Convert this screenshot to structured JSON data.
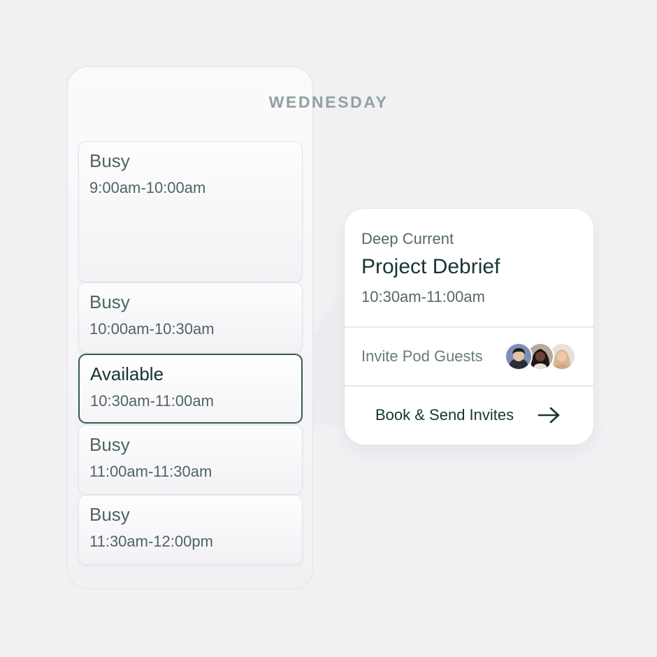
{
  "day": {
    "title": "WEDNESDAY",
    "slots": [
      {
        "status": "Busy",
        "time": "9:00am-10:00am"
      },
      {
        "status": "Busy",
        "time": "10:00am-10:30am"
      },
      {
        "status": "Available",
        "time": "10:30am-11:00am"
      },
      {
        "status": "Busy",
        "time": "11:00am-11:30am"
      },
      {
        "status": "Busy",
        "time": "11:30am-12:00pm"
      }
    ]
  },
  "event": {
    "subtitle": "Deep Current",
    "title": "Project Debrief",
    "time": "10:30am-11:00am",
    "guests_label": "Invite Pod Guests",
    "guests": [
      "guest-avatar-1",
      "guest-avatar-2",
      "guest-avatar-3"
    ],
    "book_label": "Book & Send Invites",
    "book_icon": "arrow-right-icon"
  },
  "colors": {
    "background": "#f1f1f4",
    "accent": "#163534",
    "muted_text": "#546968",
    "heading_muted": "#8fa29f",
    "selected_border": "#3a5856"
  }
}
